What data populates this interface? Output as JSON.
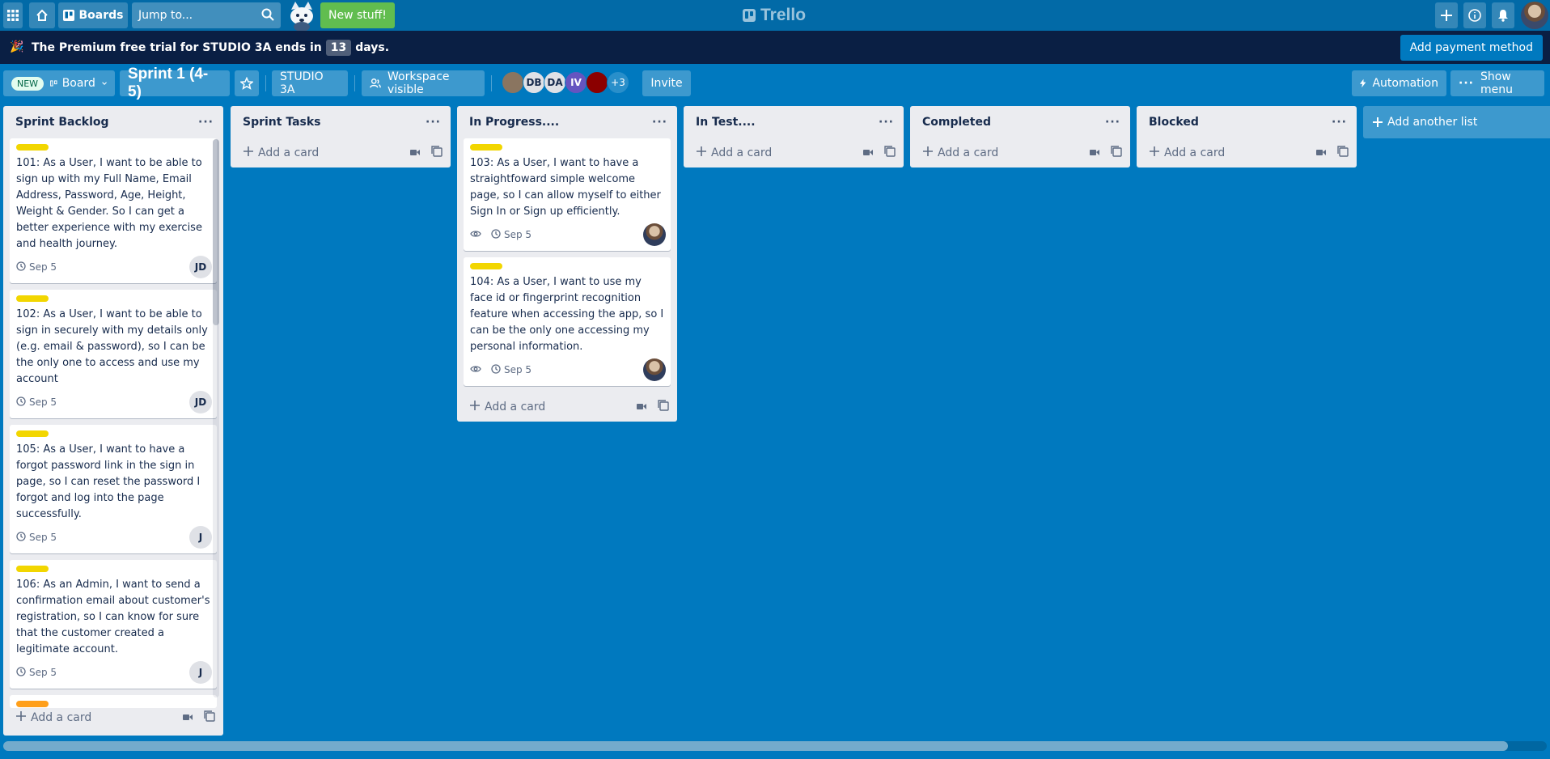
{
  "topnav": {
    "boards_label": "Boards",
    "search_placeholder": "Jump to...",
    "new_stuff_label": "New stuff!",
    "logo_text": "Trello"
  },
  "banner": {
    "msg_pre": "The Premium free trial for STUDIO 3A ends in",
    "days": "13",
    "msg_post": "days.",
    "pay_label": "Add payment method"
  },
  "boardheader": {
    "new_badge": "NEW",
    "view_label": "Board",
    "title": "Sprint 1 (4-5)",
    "workspace": "STUDIO 3A",
    "visibility": "Workspace visible",
    "members": [
      {
        "initials": "",
        "color": "#8a7560"
      },
      {
        "initials": "DB",
        "color": "#dfe1e6"
      },
      {
        "initials": "DA",
        "color": "#dfe1e6"
      },
      {
        "initials": "IV",
        "color": "#6554c0"
      },
      {
        "initials": "",
        "color": "#8b0000"
      }
    ],
    "more_members": "+3",
    "invite_label": "Invite",
    "automation_label": "Automation",
    "show_menu_label": "Show menu"
  },
  "colors": {
    "yellow_label": "#f2d600",
    "orange_label": "#ff9f1a",
    "board_bg": "#0079bf"
  },
  "lists": [
    {
      "title": "Sprint Backlog",
      "cards": [
        {
          "text": "101: As a User, I want to be able to sign up with my Full Name, Email Address, Password, Age, Height, Weight & Gender. So I can get a better experience with my exercise and health journey.",
          "due": "Sep 5",
          "member": "JD"
        },
        {
          "text": "102: As a User, I want to be able to sign in securely with my details only (e.g. email & password), so I can be the only one to access and use my account",
          "due": "Sep 5",
          "member": "JD"
        },
        {
          "text": "105: As a User, I want to have a forgot password link in the sign in page, so I can reset the password I forgot and log into the page successfully.",
          "due": "Sep 5",
          "member": "J"
        },
        {
          "text": "106: As an Admin, I want to send a confirmation email about customer's registration, so I can know for sure that the customer created a legitimate account.",
          "due": "Sep 5",
          "member": "J"
        }
      ],
      "add_card": "Add a card"
    },
    {
      "title": "Sprint Tasks",
      "add_card": "Add a card"
    },
    {
      "title": "In Progress....",
      "cards": [
        {
          "text": "103: As a User, I want to have a straightfoward simple welcome page, so I can allow myself to either Sign In or Sign up efficiently.",
          "due": "Sep 5"
        },
        {
          "text": "104: As a User, I want to use my face id or fingerprint recognition feature when accessing the app, so I can be the only one accessing my personal information.",
          "due": "Sep 5"
        }
      ],
      "add_card": "Add a card"
    },
    {
      "title": "In Test....",
      "add_card": "Add a card"
    },
    {
      "title": "Completed",
      "add_card": "Add a card"
    },
    {
      "title": "Blocked",
      "add_card": "Add a card"
    }
  ],
  "add_list_label": "Add another list"
}
